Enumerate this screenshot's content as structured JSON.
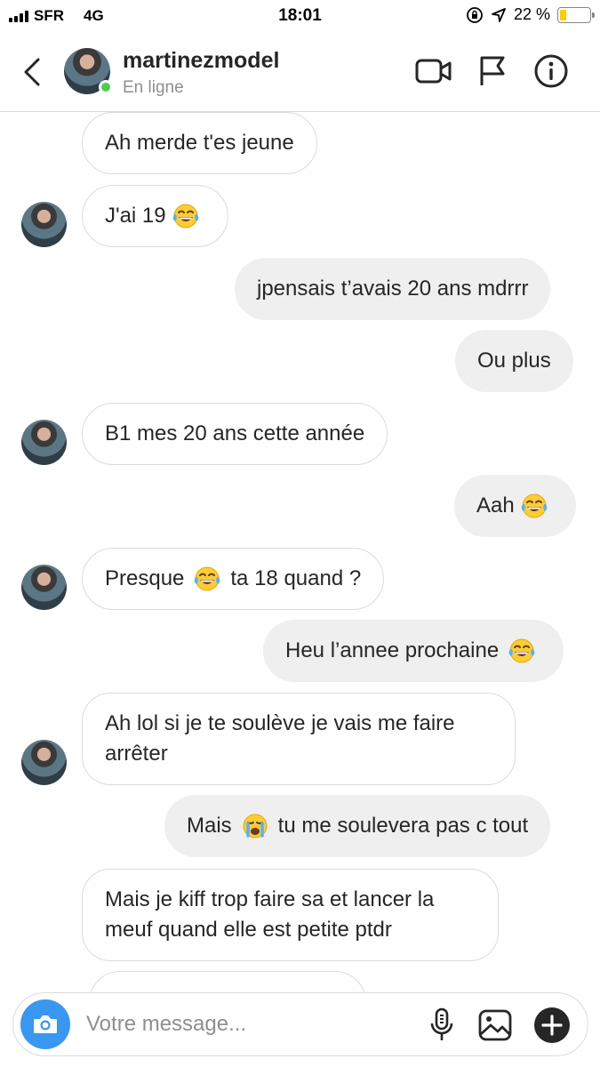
{
  "status_bar": {
    "carrier": "SFR",
    "network": "4G",
    "time": "18:01",
    "battery_percent": "22 %",
    "battery_level": 0.22
  },
  "header": {
    "username": "martinezmodel",
    "status": "En ligne",
    "icons": [
      "back-arrow-icon",
      "video-camera-icon",
      "flag-icon",
      "info-icon"
    ]
  },
  "messages": [
    {
      "from": "them",
      "text": "Ah merde t'es jeune"
    },
    {
      "from": "them",
      "text": "J'ai 19",
      "emoji": "joy"
    },
    {
      "from": "me",
      "text": "jpensais t’avais 20 ans mdrrr"
    },
    {
      "from": "me",
      "text": "Ou plus"
    },
    {
      "from": "them",
      "text": "B1 mes 20 ans cette année"
    },
    {
      "from": "me",
      "text": "Aah",
      "emoji": "joy"
    },
    {
      "from": "them",
      "text_before": "Presque",
      "emoji": "joy",
      "text_after": "ta 18 quand ?"
    },
    {
      "from": "me",
      "text": "Heu l’annee prochaine",
      "emoji": "joy"
    },
    {
      "from": "them",
      "text": "Ah lol si je te soulève je vais me faire arrêter"
    },
    {
      "from": "me",
      "text_before": "Mais",
      "emoji": "sob",
      "text_after": "tu me soulevera pas c tout"
    },
    {
      "from": "them",
      "text": "Mais je kiff trop faire sa et lancer la meuf quand elle est petite ptdr"
    }
  ],
  "composer": {
    "placeholder": "Votre message...",
    "icons": [
      "camera-icon",
      "microphone-icon",
      "gallery-icon",
      "plus-icon"
    ]
  }
}
